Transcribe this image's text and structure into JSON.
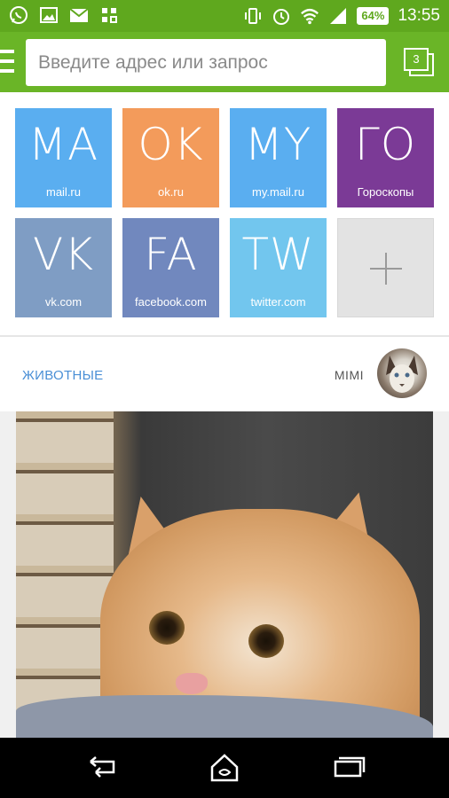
{
  "status_bar": {
    "icons_left": [
      "whatsapp-icon",
      "image-icon",
      "gmail-icon",
      "apps-icon"
    ],
    "icons_right": [
      "vibrate-icon",
      "alarm-icon",
      "wifi-icon",
      "signal-icon"
    ],
    "battery": "64%",
    "time": "13:55",
    "bg_color": "#5fa81e"
  },
  "toolbar": {
    "address_placeholder": "Введите адрес или запрос",
    "tab_count": "3",
    "bg_color": "#6ab527"
  },
  "tiles": [
    {
      "abbr": "MA",
      "label": "mail.ru",
      "color": "#5aaef0"
    },
    {
      "abbr": "OK",
      "label": "ok.ru",
      "color": "#f39b5b"
    },
    {
      "abbr": "MY",
      "label": "my.mail.ru",
      "color": "#5aaef0"
    },
    {
      "abbr": "ГО",
      "label": "Гороскопы",
      "color": "#7b3a96"
    },
    {
      "abbr": "VK",
      "label": "vk.com",
      "color": "#7f9dc4"
    },
    {
      "abbr": "FA",
      "label": "facebook.com",
      "color": "#7188be"
    },
    {
      "abbr": "TW",
      "label": "twitter.com",
      "color": "#72c6ee"
    }
  ],
  "feed": {
    "category": "ЖИВОТНЫЕ",
    "source": "MIMI"
  }
}
